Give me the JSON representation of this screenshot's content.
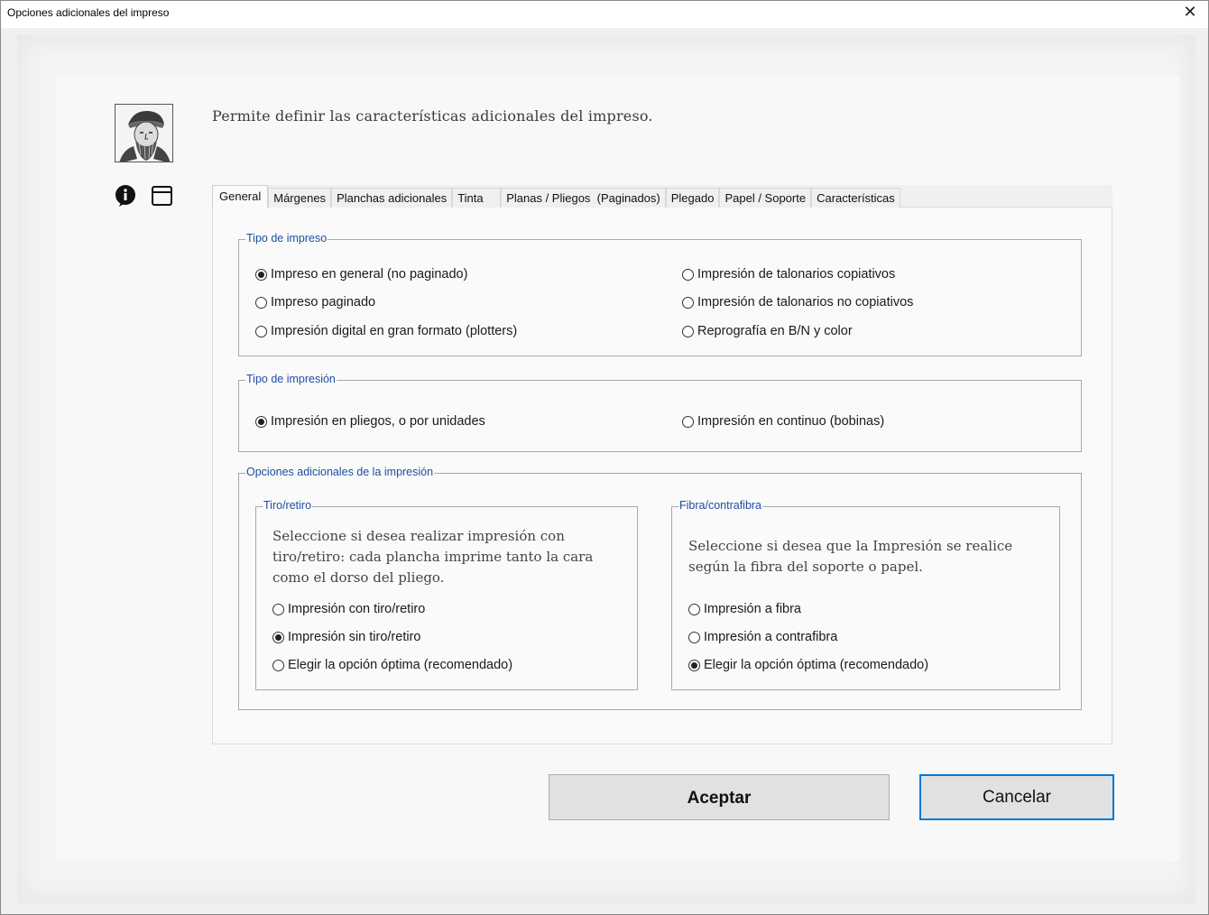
{
  "window": {
    "title": "Opciones adicionales del impreso",
    "close_symbol": "✕"
  },
  "header": {
    "description": "Permite definir las características adicionales del impreso.",
    "logo": "gutenberg-portrait-icon",
    "side_icons": [
      "info-icon",
      "window-icon"
    ]
  },
  "tabs": [
    {
      "label": "General",
      "active": true
    },
    {
      "label": "Márgenes"
    },
    {
      "label": "Planchas adicionales"
    },
    {
      "label": "Tinta"
    },
    {
      "label": "Planas / Pliegos  (Paginados)"
    },
    {
      "label": "Plegado"
    },
    {
      "label": "Papel / Soporte"
    },
    {
      "label": "Características"
    }
  ],
  "tipo_impreso": {
    "legend": "Tipo de impreso",
    "options": [
      {
        "label": "Impreso en general (no paginado)",
        "selected": true
      },
      {
        "label": "Impreso paginado",
        "selected": false
      },
      {
        "label": "Impresión digital en gran formato (plotters)",
        "selected": false
      },
      {
        "label": "Impresión de talonarios copiativos",
        "selected": false
      },
      {
        "label": "Impresión de talonarios no copiativos",
        "selected": false
      },
      {
        "label": "Reprografía en B/N y color",
        "selected": false
      }
    ]
  },
  "tipo_impresion": {
    "legend": "Tipo de impresión",
    "options": [
      {
        "label": "Impresión en pliegos, o por unidades",
        "selected": true
      },
      {
        "label": "Impresión en continuo (bobinas)",
        "selected": false
      }
    ]
  },
  "opciones_adicionales": {
    "legend": "Opciones adicionales de la impresión",
    "tiro_retiro": {
      "legend": "Tiro/retiro",
      "help_lines": [
        "Seleccione si desea realizar impresión con",
        "tiro/retiro: cada plancha imprime tanto la cara",
        "como el dorso del pliego."
      ],
      "options": [
        {
          "label": "Impresión con tiro/retiro",
          "selected": false
        },
        {
          "label": "Impresión sin tiro/retiro",
          "selected": true
        },
        {
          "label": "Elegir la opción óptima (recomendado)",
          "selected": false
        }
      ]
    },
    "fibra": {
      "legend": "Fibra/contrafibra",
      "help_lines": [
        "Seleccione si desea que la Impresión se realice",
        "según la fibra del soporte o papel."
      ],
      "options": [
        {
          "label": "Impresión a fibra",
          "selected": false
        },
        {
          "label": "Impresión a contrafibra",
          "selected": false
        },
        {
          "label": "Elegir la opción óptima (recomendado)",
          "selected": true
        }
      ]
    }
  },
  "buttons": {
    "accept": "Aceptar",
    "cancel": "Cancelar"
  }
}
